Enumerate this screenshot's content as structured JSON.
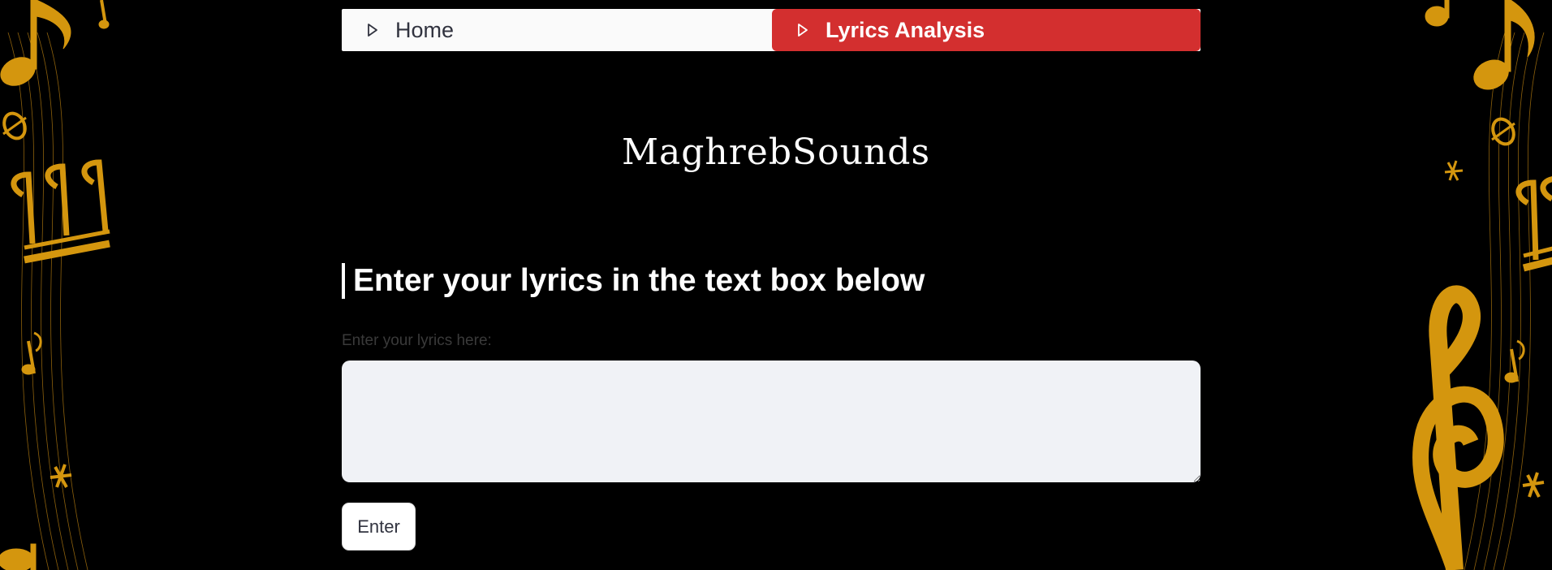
{
  "nav": {
    "items": [
      {
        "label": "Home",
        "icon": "play-outline-icon",
        "active": false
      },
      {
        "label": "Lyrics Analysis",
        "icon": "play-outline-icon",
        "active": true
      }
    ],
    "active_color": "#d32f2f"
  },
  "app": {
    "title": "MaghrebSounds"
  },
  "main": {
    "heading": "Enter your lyrics in the text box below",
    "input_label": "Enter your lyrics here:",
    "input_value": "",
    "enter_label": "Enter"
  },
  "theme": {
    "background": "#000000",
    "decoration_color": "#d4960e"
  }
}
